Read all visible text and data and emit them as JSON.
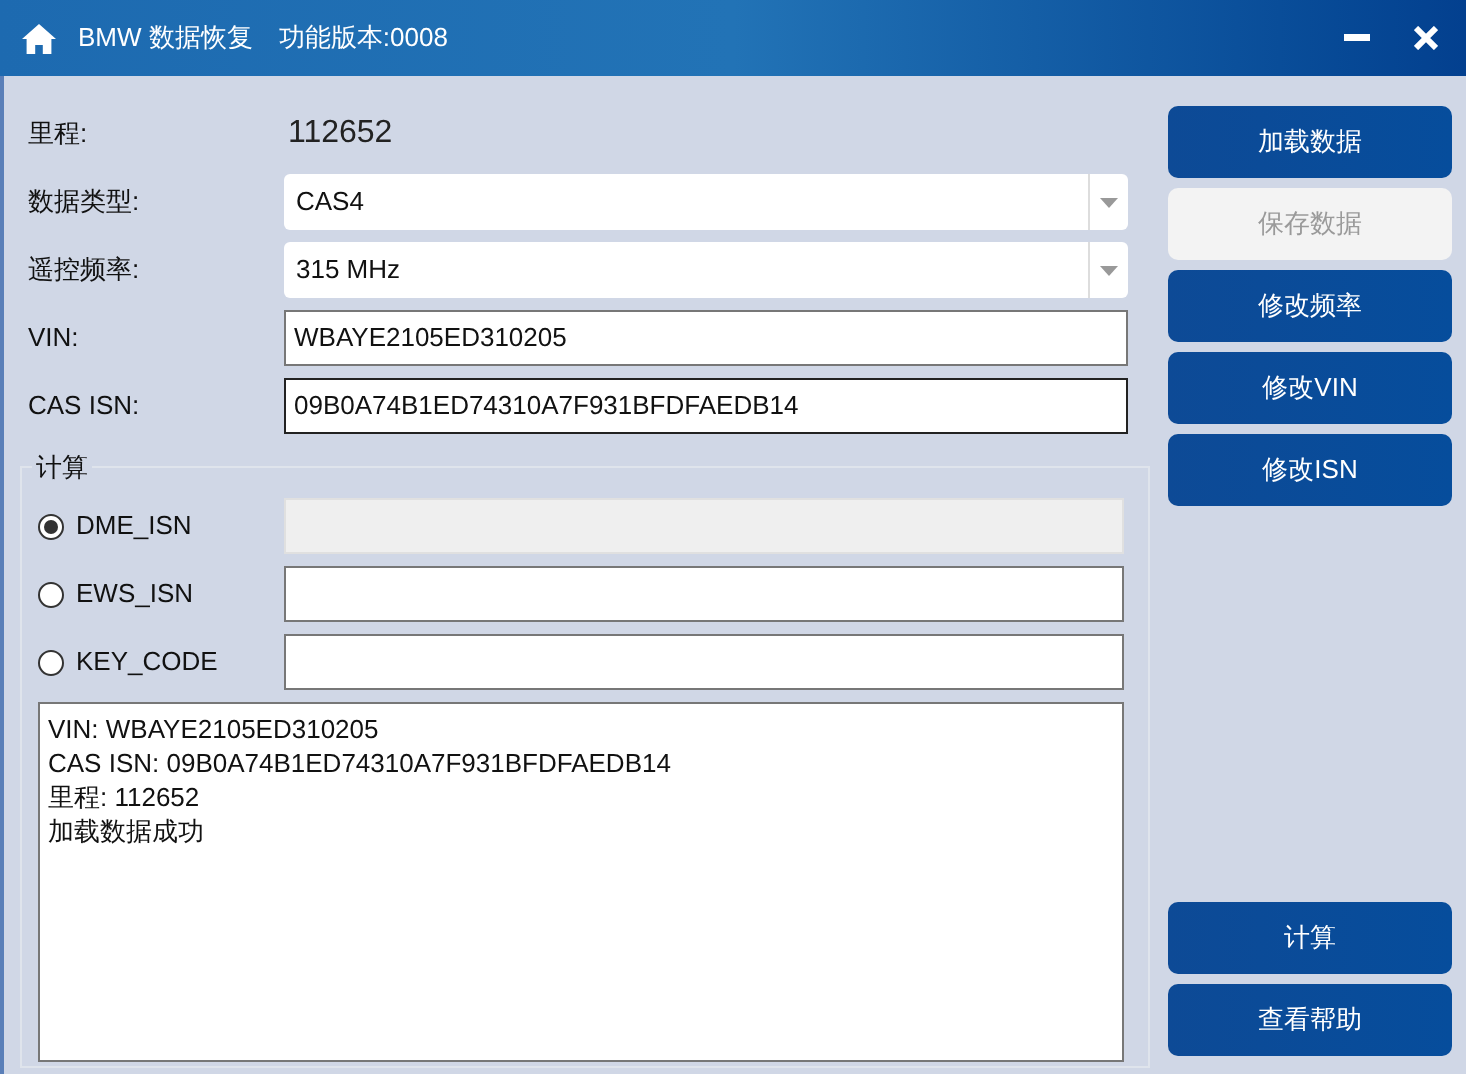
{
  "window": {
    "title": "BMW 数据恢复",
    "version": "功能版本:0008"
  },
  "fields": [
    {
      "kind": "value",
      "label": "里程:",
      "value": "112652"
    },
    {
      "kind": "select",
      "label": "数据类型:",
      "value": "CAS4"
    },
    {
      "kind": "select",
      "label": "遥控频率:",
      "value": "315 MHz"
    },
    {
      "kind": "text",
      "label": "VIN:",
      "value": "WBAYE2105ED310205",
      "focused": false
    },
    {
      "kind": "text",
      "label": "CAS ISN:",
      "value": "09B0A74B1ED74310A7F931BFDFAEDB14",
      "focused": true
    }
  ],
  "calc": {
    "title": "计算",
    "options": [
      {
        "label": "DME_ISN",
        "selected": true,
        "disabled": true
      },
      {
        "label": "EWS_ISN",
        "selected": false,
        "disabled": false
      },
      {
        "label": "KEY_CODE",
        "selected": false,
        "disabled": false
      }
    ]
  },
  "log": [
    "VIN: WBAYE2105ED310205",
    "CAS ISN: 09B0A74B1ED74310A7F931BFDFAEDB14",
    "里程: 112652",
    "加载数据成功"
  ],
  "buttons": [
    {
      "label": "加载数据",
      "disabled": false
    },
    {
      "label": "保存数据",
      "disabled": true
    },
    {
      "label": "修改频率",
      "disabled": false
    },
    {
      "label": "修改VIN",
      "disabled": false
    },
    {
      "label": "修改ISN",
      "disabled": false
    }
  ],
  "bottom_buttons": [
    {
      "label": "计算",
      "disabled": false
    },
    {
      "label": "查看帮助",
      "disabled": false
    }
  ]
}
